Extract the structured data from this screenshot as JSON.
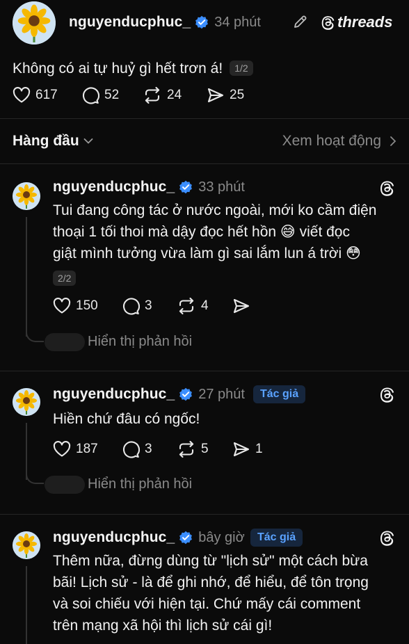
{
  "header": {
    "username": "nguyenducphuc_",
    "time": "34 phút",
    "brand": "threads",
    "post_text": "Không có ai tự huỷ gì hết trơn á!",
    "pager": "1/2",
    "likes": "617",
    "comments": "52",
    "reposts": "24",
    "shares": "25"
  },
  "sort": {
    "label": "Hàng đầu",
    "activity_link": "Xem hoạt động"
  },
  "replies": [
    {
      "username": "nguyenducphuc_",
      "time": "33 phút",
      "text_lines": [
        "Tui đang công tác ở nước ngoài, mới ko cầm điện",
        "thoại 1 tối thoi mà dậy đọc hết hồn 😅 viết đọc",
        "giật mình tưởng vừa làm gì sai lắm lun á trời 😳"
      ],
      "pager": "2/2",
      "likes": "150",
      "comments": "3",
      "reposts": "4",
      "show_replies": "Hiển thị phản hồi"
    },
    {
      "username": "nguyenducphuc_",
      "time": "27 phút",
      "badge": "Tác giả",
      "text_lines": [
        "Hiền chứ đâu có ngốc!"
      ],
      "likes": "187",
      "comments": "3",
      "reposts": "5",
      "shares": "1",
      "show_replies": "Hiển thị phản hồi"
    },
    {
      "username": "nguyenducphuc_",
      "time": "bây giờ",
      "badge": "Tác giả",
      "text_lines": [
        "Thêm nữa, đừng dùng từ \"lịch sử\" một cách bừa",
        "bãi! Lịch sử - là để ghi nhớ, để hiểu, để tôn trọng",
        "và soi chiếu với hiện tại. Chứ mấy cái comment",
        "trên mạng xã hội thì lịch sử cái gì!"
      ]
    }
  ],
  "colors": {
    "background": "#0b0b0b",
    "verified": "#3b8eff",
    "badge_bg": "#16263d",
    "badge_text": "#5aa2ff",
    "muted": "#8a8a8a"
  }
}
